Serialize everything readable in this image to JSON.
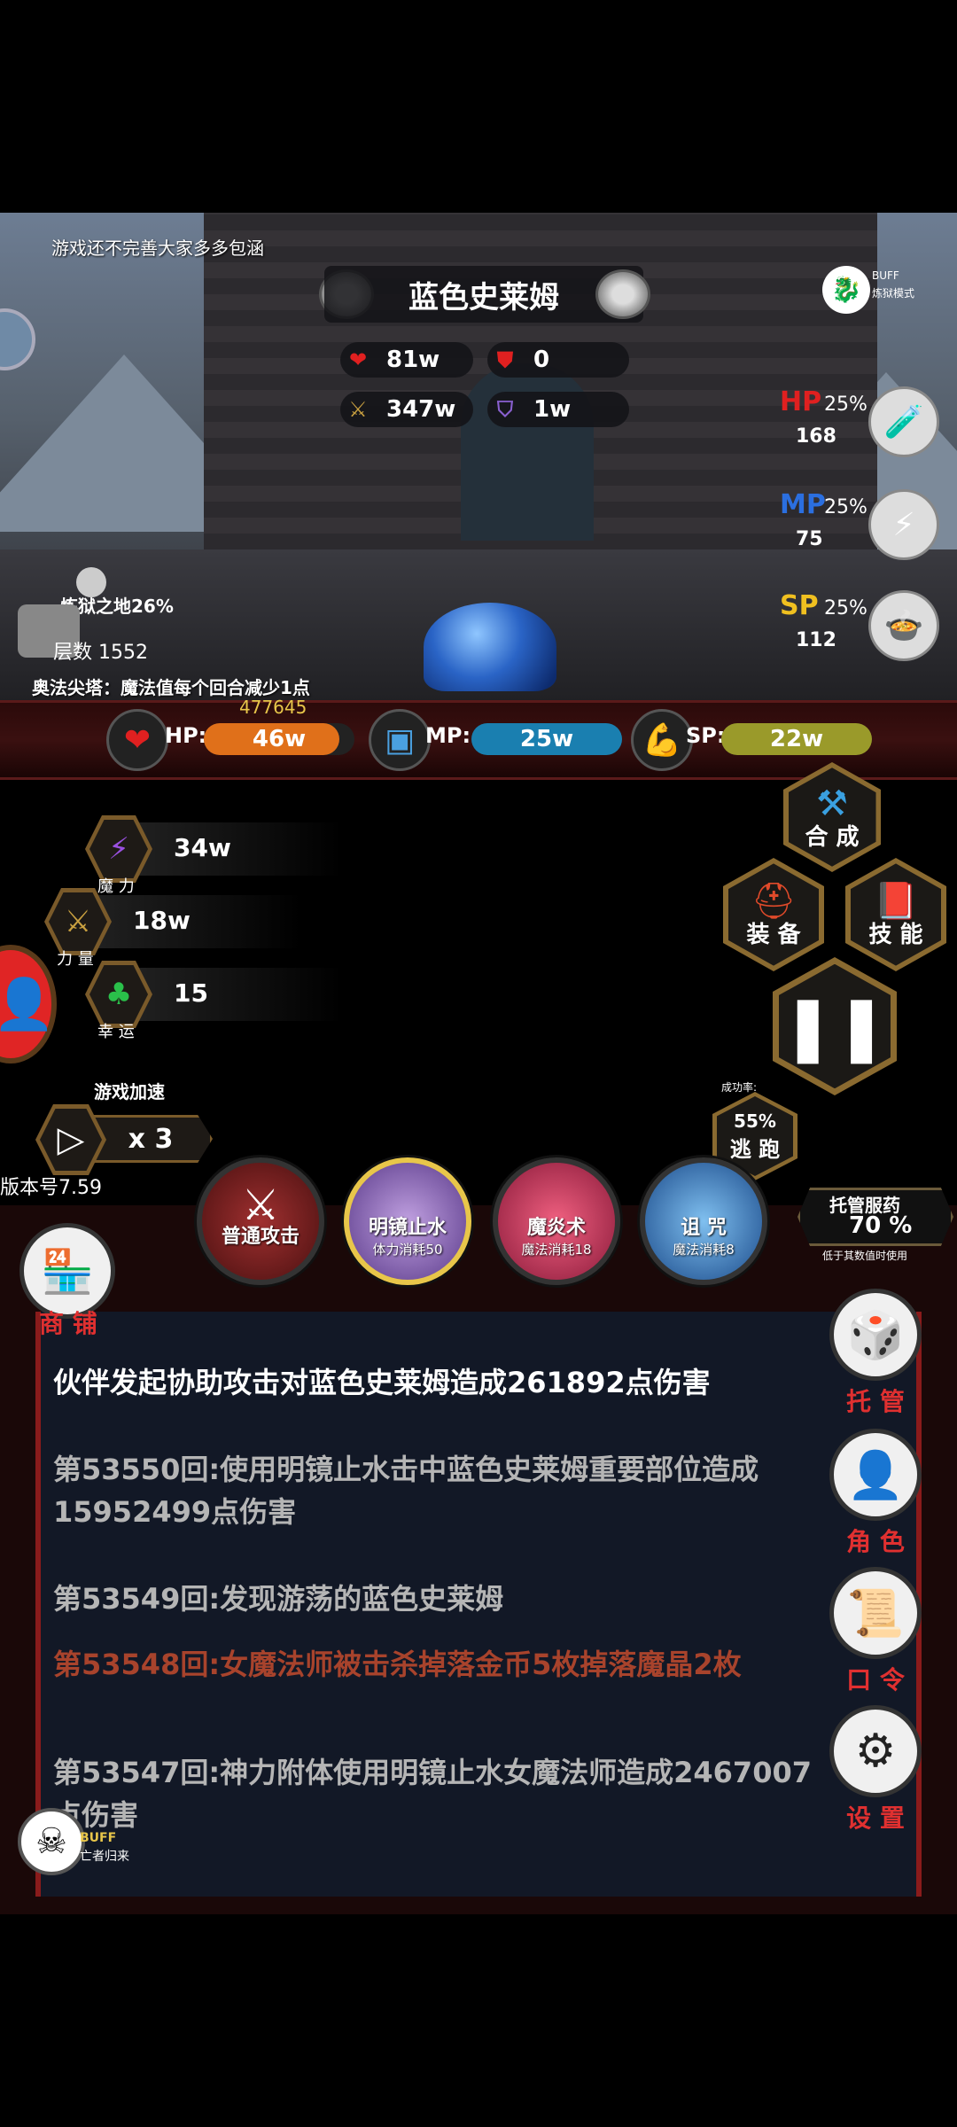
{
  "notice": "游戏还不完善大家多多包涵",
  "boss": {
    "name": "蓝色史莱姆"
  },
  "boss_stats": {
    "hp": "81w",
    "defense": "0",
    "attack": "347w",
    "magic_defense": "1w"
  },
  "top_buff": {
    "label": "BUFF",
    "mode": "炼狱模式"
  },
  "potions": [
    {
      "key": "HP",
      "pct": "25%",
      "count": "168",
      "color": "#e02020",
      "icon": "heart-potion-icon"
    },
    {
      "key": "MP",
      "pct": "25%",
      "count": "75",
      "color": "#2b6fe0",
      "icon": "lightning-potion-icon"
    },
    {
      "key": "SP",
      "pct": "25%",
      "count": "112",
      "color": "#f0c020",
      "icon": "food-icon"
    }
  ],
  "area": {
    "name": "炼狱之地26%",
    "floor": "层数 1552"
  },
  "tower_msg": "奥法尖塔：魔法值每个回合减少1点",
  "bars": {
    "hp_label": "HP:",
    "hp_value": "46w",
    "hp_extra": "477645",
    "hp_color": "#e0701a",
    "hp_fill": 0.9,
    "mp_label": "MP:",
    "mp_value": "25w",
    "mp_color": "#1a7fb0",
    "mp_fill": 1.0,
    "sp_label": "SP:",
    "sp_value": "22w",
    "sp_color": "#9a9a2a",
    "sp_fill": 1.0
  },
  "attributes": [
    {
      "name": "魔 力",
      "value": "34w",
      "icon": "magic-icon"
    },
    {
      "name": "力 量",
      "value": "18w",
      "icon": "sword-icon"
    },
    {
      "name": "幸 运",
      "value": "15",
      "icon": "clover-icon"
    }
  ],
  "speed": {
    "title": "游戏加速",
    "multiplier": "x 3"
  },
  "version": "版本号7.59",
  "menu": {
    "synth": "合 成",
    "equip": "装 备",
    "skill": "技 能"
  },
  "escape": {
    "success": "成功率:",
    "rate": "55%",
    "label": "逃 跑"
  },
  "skills": [
    {
      "name": "普通攻击",
      "cost": "",
      "color": "#6a2020"
    },
    {
      "name": "明镜止水",
      "cost": "体力消耗50",
      "color": "#8a6ab0"
    },
    {
      "name": "魔炎术",
      "cost": "魔法消耗18",
      "color": "#c03a5a"
    },
    {
      "name": "诅 咒",
      "cost": "魔法消耗8",
      "color": "#3a8ad0"
    }
  ],
  "auto_med": {
    "title": "托管服药",
    "value": "70 %",
    "note": "低于其数值时使用"
  },
  "shop": "商 铺",
  "side": {
    "auto": "托 管",
    "role": "角 色",
    "code": "口 令",
    "settings": "设 置"
  },
  "log": [
    {
      "text": "伙伴发起协助攻击对蓝色史莱姆造成261892点伤害",
      "color": "#ffffff"
    },
    {
      "text": "第53550回:使用明镜止水击中蓝色史莱姆重要部位造成15952499点伤害",
      "color": "#b5b5b5"
    },
    {
      "text": "第53549回:发现游荡的蓝色史莱姆",
      "color": "#b5b5b5"
    },
    {
      "text": "第53548回:女魔法师被击杀掉落金币5枚掉落魔晶2枚",
      "color": "#a8432c"
    },
    {
      "text": "第53547回:神力附体使用明镜止水女魔法师造成2467007点伤害",
      "color": "#b5b5b5"
    }
  ],
  "bottom_buff": {
    "label": "BUFF",
    "name": "亡者归来"
  }
}
